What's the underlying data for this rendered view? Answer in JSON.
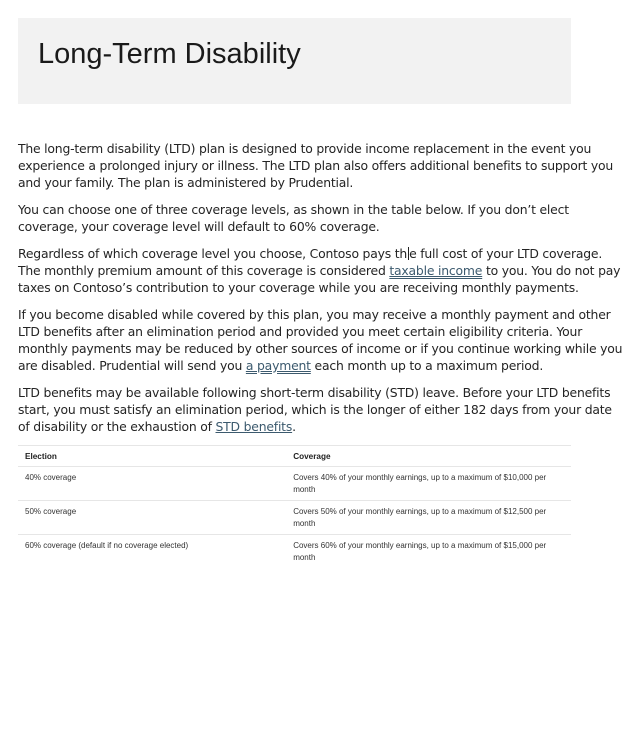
{
  "header": {
    "title": "Long-Term Disability"
  },
  "paragraphs": {
    "p1": {
      "l1": "The long-term disability (LTD) plan is designed to provide income replacement in the event you",
      "l2": "experience a prolonged injury or illness. The LTD plan also offers additional benefits to support you",
      "l3": "and your family. The plan is administered by Prudential."
    },
    "p2": {
      "l1": "You can choose one of three coverage levels, as shown in the table below. If you don’t elect",
      "l2": "coverage, your coverage level will default to 60% coverage."
    },
    "p3": {
      "l1a": "Regardless of which coverage level you choose, Contoso pays th",
      "l1b": "e full cost of your LTD coverage.",
      "l2a": "The monthly premium amount of this coverage is considered ",
      "link_taxable": "taxable income",
      "l2b": " to you. You do not pay",
      "l3": "taxes on Contoso’s contribution to your coverage while you are receiving monthly payments."
    },
    "p4": {
      "l1": "If you become disabled while covered by this plan, you may receive a monthly payment and other",
      "l2": "LTD benefits after an elimination period and provided you meet certain eligibility criteria. Your",
      "l3": "monthly payments may be reduced by other sources of income or if you continue working while you",
      "l4a": "are disabled. Prudential will send you ",
      "link_payment": "a payment",
      "l4b": " each month up to a maximum period."
    },
    "p5": {
      "l1": "LTD benefits may be available following short-term disability (STD) leave. Before your LTD benefits",
      "l2": "start, you must satisfy an elimination period, which is the longer of either 182 days from your date",
      "l3a": "of disability or the exhaustion of ",
      "link_std": "STD benefits",
      "l3b": "."
    }
  },
  "table": {
    "headers": {
      "election": "Election",
      "coverage": "Coverage"
    },
    "rows": [
      {
        "election": "40% coverage",
        "coverage_l1": "Covers 40% of your monthly earnings, up to a maximum of $10,000 per",
        "coverage_l2": "month"
      },
      {
        "election": "50% coverage",
        "coverage_l1": "Covers 50% of your monthly earnings, up to a maximum of $12,500 per",
        "coverage_l2": "month"
      },
      {
        "election": "60% coverage (default if no coverage elected)",
        "coverage_l1": "Covers 60% of your monthly earnings, up to a maximum of $15,000 per",
        "coverage_l2": "month"
      }
    ]
  },
  "colors": {
    "header_band": "#f2f2f2",
    "link": "#3c5a6e",
    "text": "#242424",
    "table_rule": "#e6e6e6"
  }
}
